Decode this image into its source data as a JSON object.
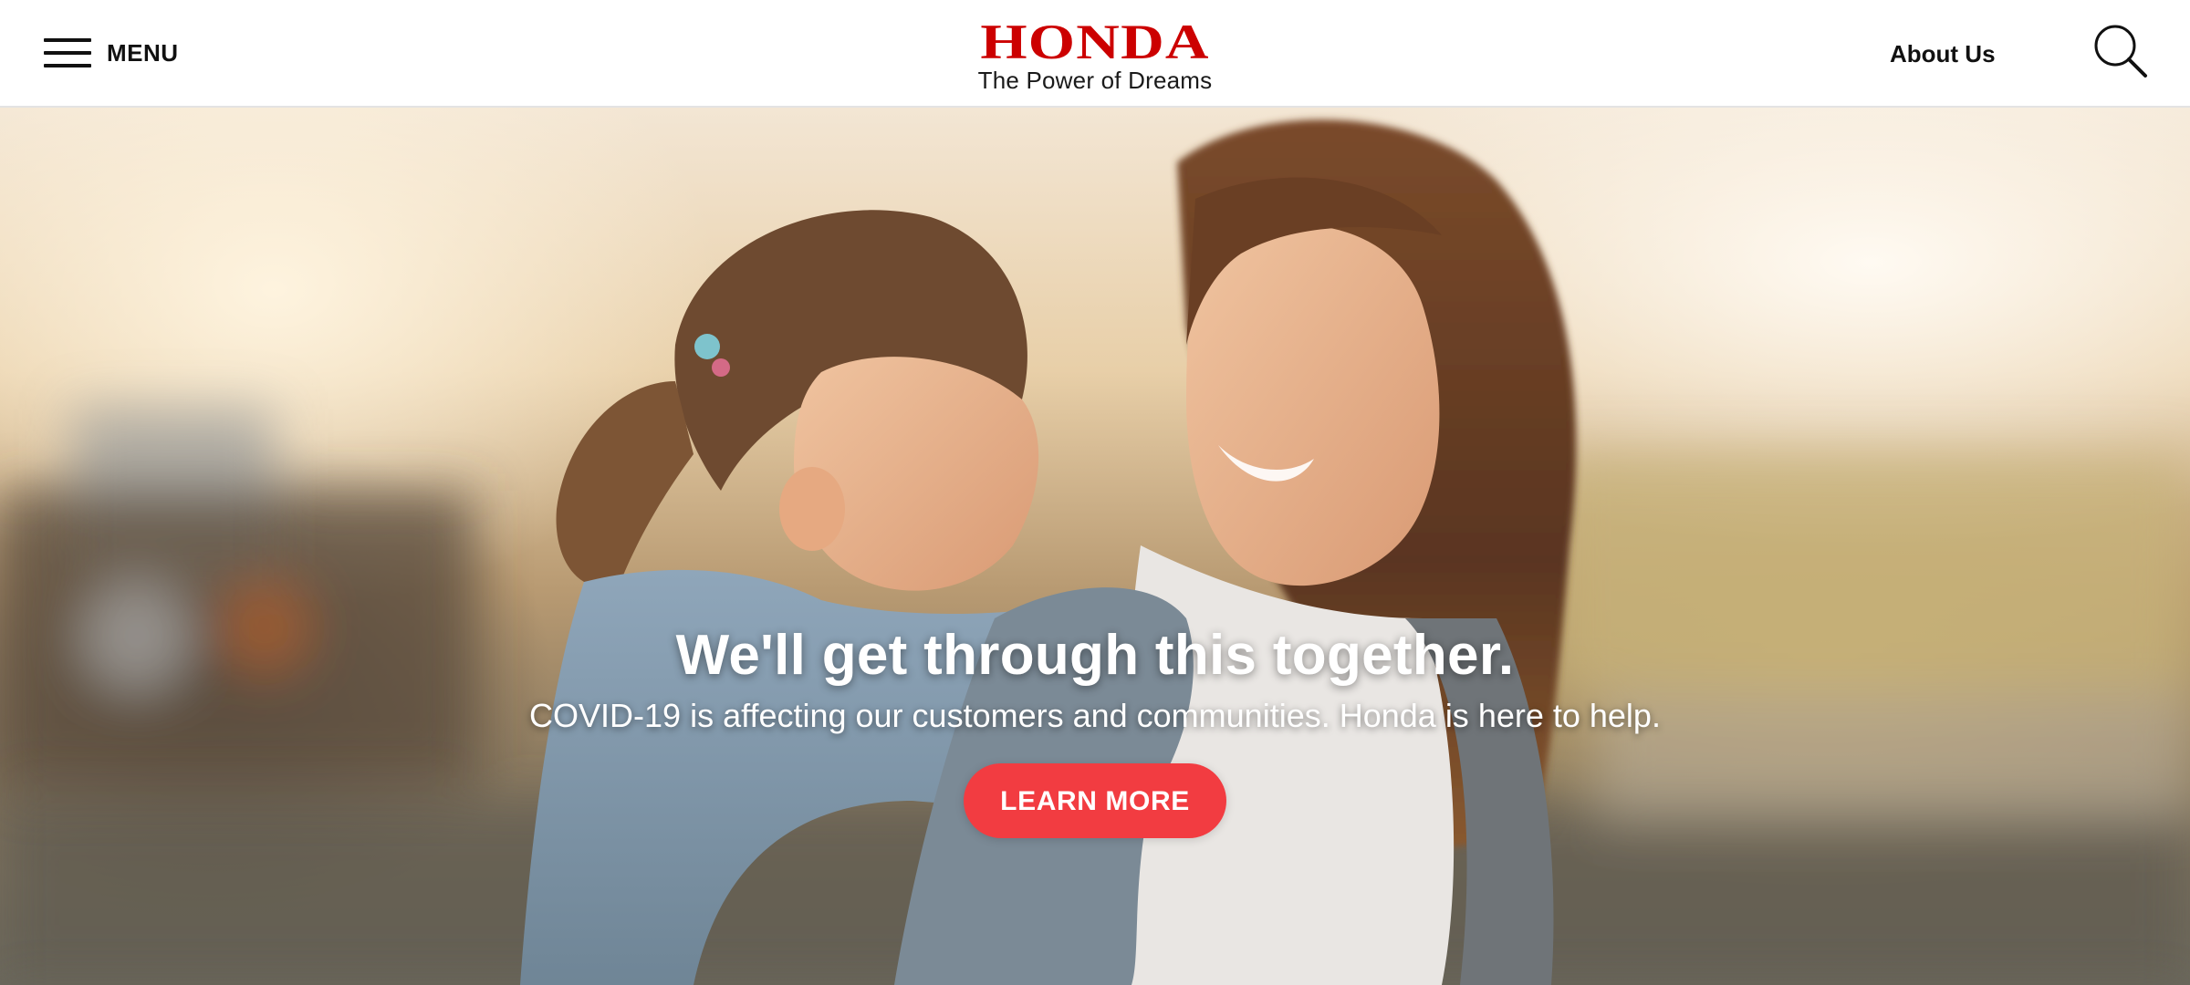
{
  "header": {
    "menu_label": "MENU",
    "logo_wordmark": "HONDA",
    "logo_tagline": "The Power of Dreams",
    "about_link": "About Us",
    "search_icon": "search-icon",
    "menu_icon": "hamburger-icon"
  },
  "hero": {
    "headline": "We'll get through this together.",
    "subtext": "COVID-19 is affecting our customers and communities. Honda is here to help.",
    "cta_label": "LEARN MORE"
  },
  "colors": {
    "brand_red": "#cc0000",
    "cta_red": "#f23c41",
    "header_bg": "#ffffff",
    "text_dark": "#111111"
  }
}
